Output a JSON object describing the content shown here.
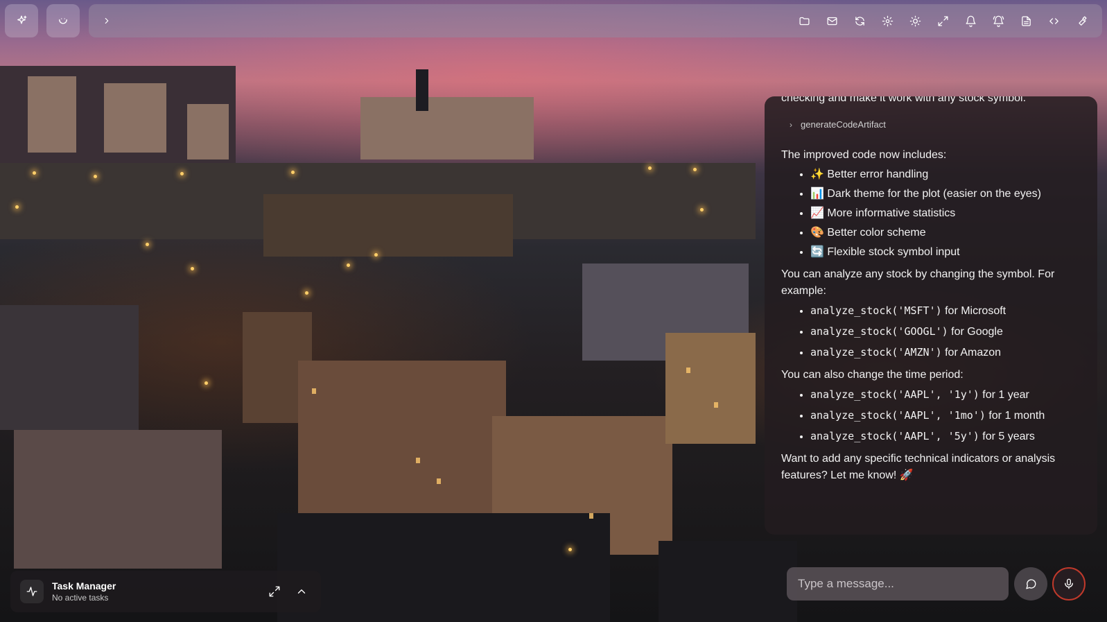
{
  "background": {
    "accent_sky": "#b77685",
    "lights": "#ffcf6a"
  },
  "top_left_buttons": [
    {
      "icon": "sparkles-icon"
    },
    {
      "icon": "smile-icon"
    }
  ],
  "topbar": {
    "expand_icon": "chevron-right-icon",
    "icons": [
      "folder-icon",
      "mail-icon",
      "refresh-icon",
      "gear-icon",
      "sun-icon",
      "maximize-icon",
      "bell-icon",
      "bell-ring-icon",
      "document-icon",
      "code-icon",
      "wrench-icon"
    ]
  },
  "chat": {
    "truncated_text": "checking and make it work with any stock symbol.",
    "tool_call": "generateCodeArtifact",
    "intro": "The improved code now includes:",
    "features": [
      "✨ Better error handling",
      "📊 Dark theme for the plot (easier on the eyes)",
      "📈 More informative statistics",
      "🎨 Better color scheme",
      "🔄 Flexible stock symbol input"
    ],
    "analyze_text": "You can analyze any stock by changing the symbol. For example:",
    "symbol_examples": [
      {
        "code": "analyze_stock('MSFT')",
        "desc": " for Microsoft"
      },
      {
        "code": "analyze_stock('GOOGL')",
        "desc": " for Google"
      },
      {
        "code": "analyze_stock('AMZN')",
        "desc": " for Amazon"
      }
    ],
    "period_text": "You can also change the time period:",
    "period_examples": [
      {
        "code": "analyze_stock('AAPL', '1y')",
        "desc": " for 1 year"
      },
      {
        "code": "analyze_stock('AAPL', '1mo')",
        "desc": " for 1 month"
      },
      {
        "code": "analyze_stock('AAPL', '5y')",
        "desc": " for 5 years"
      }
    ],
    "closing": "Want to add any specific technical indicators or analysis features? Let me know! 🚀"
  },
  "task_manager": {
    "title": "Task Manager",
    "status": "No active tasks"
  },
  "composer": {
    "placeholder": "Type a message...",
    "chat_icon": "message-circle-icon",
    "mic_icon": "microphone-icon",
    "mic_ring_color": "#c0392b"
  }
}
